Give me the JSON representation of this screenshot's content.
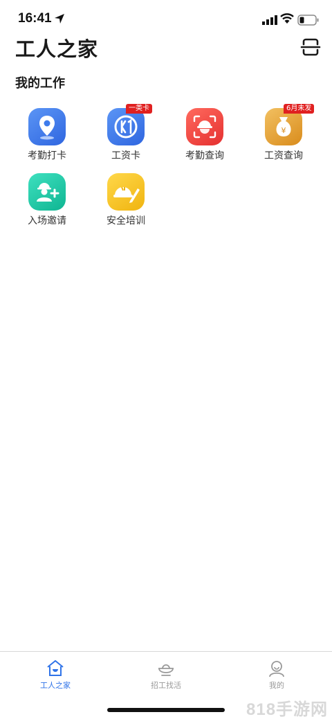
{
  "status_bar": {
    "time": "16:41"
  },
  "header": {
    "title": "工人之家",
    "scan_icon": "scan-icon"
  },
  "section": {
    "title": "我的工作"
  },
  "tiles": [
    {
      "label": "考勤打卡",
      "icon": "location-pin-icon",
      "badge": ""
    },
    {
      "label": "工资卡",
      "icon": "bank-card-icon",
      "badge": "一类卡"
    },
    {
      "label": "考勤查询",
      "icon": "face-scan-icon",
      "badge": ""
    },
    {
      "label": "工资查询",
      "icon": "money-bag-icon",
      "badge": "6月未发"
    },
    {
      "label": "入场邀请",
      "icon": "add-worker-icon",
      "badge": ""
    },
    {
      "label": "安全培训",
      "icon": "helmet-pencil-icon",
      "badge": ""
    }
  ],
  "bottom_nav": [
    {
      "label": "工人之家",
      "icon": "home-icon",
      "active": true
    },
    {
      "label": "招工找活",
      "icon": "ingot-icon",
      "active": false
    },
    {
      "label": "我的",
      "icon": "user-icon",
      "active": false
    }
  ],
  "watermark": "818手游网",
  "colors": {
    "accent": "#2f73e8",
    "badge": "#e02020",
    "blue_tile": "#3d7bec",
    "red_tile": "#f04545",
    "orange_tile": "#e6a43a",
    "teal_tile": "#1dc9a6",
    "yellow_tile": "#f5c21e"
  }
}
